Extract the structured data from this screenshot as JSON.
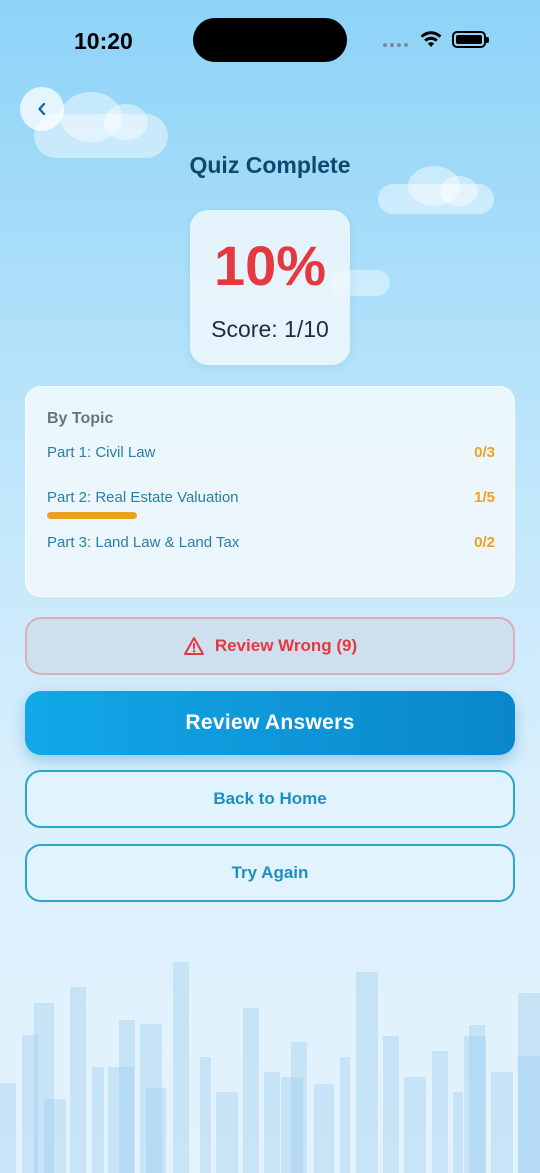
{
  "status_bar": {
    "time": "10:20"
  },
  "header": {
    "title": "Quiz Complete"
  },
  "score": {
    "percent": "10%",
    "score_text": "Score: 1/10",
    "percent_color": "#e5383f"
  },
  "topics": {
    "heading": "By Topic",
    "items": [
      {
        "label": "Part 1: Civil Law",
        "score": "0/3",
        "progress": 0
      },
      {
        "label": "Part 2: Real Estate Valuation",
        "score": "1/5",
        "progress": 0.2
      },
      {
        "label": "Part 3: Land Law & Land Tax",
        "score": "0/2",
        "progress": 0
      }
    ]
  },
  "actions": {
    "review_wrong_label": "Review Wrong (9)",
    "review_answers_label": "Review Answers",
    "back_home_label": "Back to Home",
    "try_again_label": "Try Again"
  },
  "icons": {
    "back": "chevron-left-icon",
    "warning": "warning-triangle-icon",
    "wifi": "wifi-icon",
    "battery": "battery-icon"
  },
  "colors": {
    "accent": "#0a86cc",
    "danger": "#e5383f",
    "warning": "#f0a020",
    "title": "#0e4a6e"
  }
}
